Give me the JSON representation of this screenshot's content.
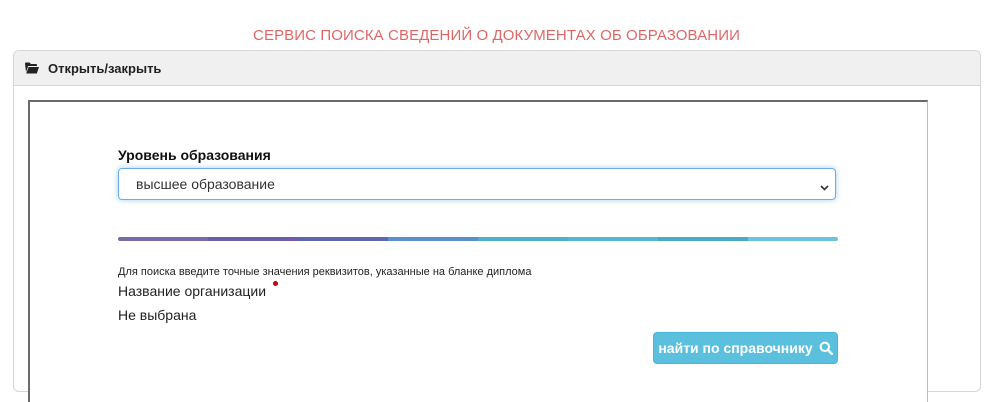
{
  "header": {
    "title": "СЕРВИС ПОИСКА СВЕДЕНИЙ О ДОКУМЕНТАХ ОБ ОБРАЗОВАНИИ",
    "title_color": "#e06666"
  },
  "panel": {
    "toggle_label": "Открыть/закрыть",
    "toggle_icon": "folder-open-icon"
  },
  "form": {
    "level_label": "Уровень образования",
    "level_selected": "высшее образование",
    "progress_colors": [
      "#7b6aa8",
      "#6b5ea5",
      "#5f66ad",
      "#5a8fc9",
      "#4fb0c9",
      "#56b6cf",
      "#4aa9c4",
      "#6cc4dc"
    ],
    "hint": "Для поиска введите точные значения реквизитов, указанные на бланке диплома",
    "org_label": "Название организации",
    "org_value": "Не выбрана",
    "search_button_label": "найти по справочнику",
    "search_button_icon": "search-icon",
    "search_button_color": "#5bc0de"
  }
}
